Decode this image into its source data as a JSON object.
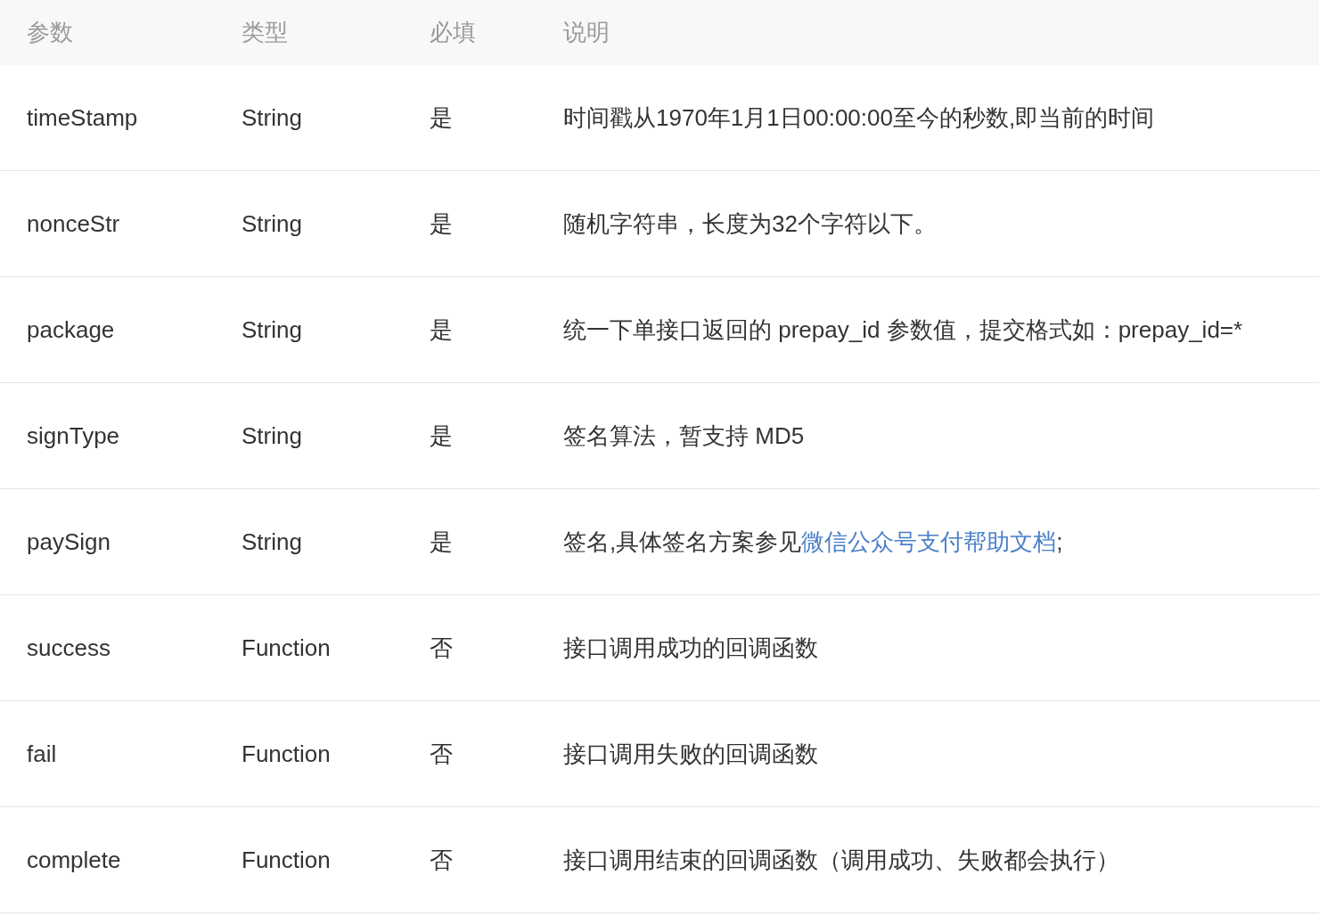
{
  "table": {
    "columns": [
      "参数",
      "类型",
      "必填",
      "说明"
    ],
    "rows": [
      {
        "name": "timeStamp",
        "type": "String",
        "required": "是",
        "description": [
          {
            "kind": "text",
            "text": "时间戳从1970年1月1日00:00:00至今的秒数,即当前的时间"
          }
        ]
      },
      {
        "name": "nonceStr",
        "type": "String",
        "required": "是",
        "description": [
          {
            "kind": "text",
            "text": "随机字符串，长度为32个字符以下。"
          }
        ]
      },
      {
        "name": "package",
        "type": "String",
        "required": "是",
        "description": [
          {
            "kind": "text",
            "text": "统一下单接口返回的 prepay_id 参数值，提交格式如：prepay_id=*"
          }
        ]
      },
      {
        "name": "signType",
        "type": "String",
        "required": "是",
        "description": [
          {
            "kind": "text",
            "text": "签名算法，暂支持 MD5"
          }
        ]
      },
      {
        "name": "paySign",
        "type": "String",
        "required": "是",
        "description": [
          {
            "kind": "text",
            "text": "签名,具体签名方案参见"
          },
          {
            "kind": "link",
            "text": "微信公众号支付帮助文档"
          },
          {
            "kind": "text",
            "text": ";"
          }
        ]
      },
      {
        "name": "success",
        "type": "Function",
        "required": "否",
        "description": [
          {
            "kind": "text",
            "text": "接口调用成功的回调函数"
          }
        ]
      },
      {
        "name": "fail",
        "type": "Function",
        "required": "否",
        "description": [
          {
            "kind": "text",
            "text": "接口调用失败的回调函数"
          }
        ]
      },
      {
        "name": "complete",
        "type": "Function",
        "required": "否",
        "description": [
          {
            "kind": "text",
            "text": "接口调用结束的回调函数（调用成功、失败都会执行）"
          }
        ]
      }
    ]
  }
}
